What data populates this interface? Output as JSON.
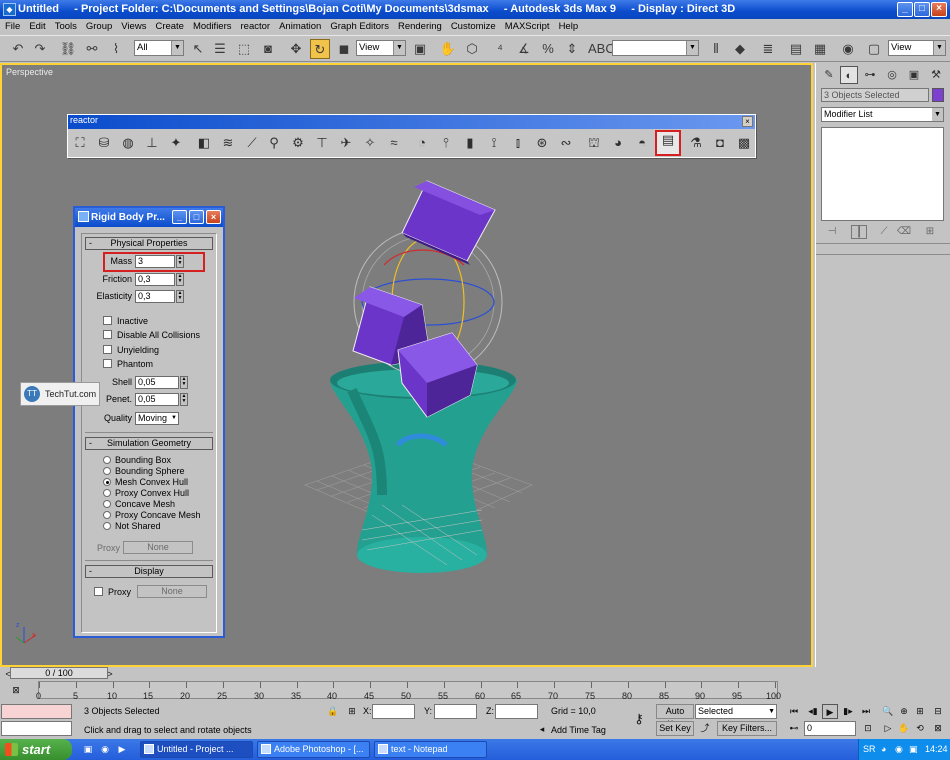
{
  "window": {
    "title": "Untitled     - Project Folder: C:\\Documents and Settings\\Bojan Coti\\My Documents\\3dsmax     - Autodesk 3ds Max 9     - Display : Direct 3D",
    "minimize": "_",
    "maximize": "□",
    "close": "×"
  },
  "menu": [
    "File",
    "Edit",
    "Tools",
    "Group",
    "Views",
    "Create",
    "Modifiers",
    "reactor",
    "Animation",
    "Graph Editors",
    "Rendering",
    "Customize",
    "MAXScript",
    "Help"
  ],
  "toolbar": {
    "selection_filter": "All",
    "ref_coord": "View",
    "named_selection": "",
    "view_dropdown": "View"
  },
  "viewport": {
    "label": "Perspective",
    "background": "#7d7d7d",
    "cube_color": "#6a35c8",
    "vase_color": "#2aa89a"
  },
  "reactor_toolbar": {
    "title": "reactor",
    "close": "×"
  },
  "rigid_body": {
    "title": "Rigid Body Pr...",
    "physical_header": "Physical Properties",
    "mass_label": "Mass",
    "mass_value": "3",
    "friction_label": "Friction",
    "friction_value": "0,3",
    "elasticity_label": "Elasticity",
    "elasticity_value": "0,3",
    "checks": [
      "Inactive",
      "Disable All Collisions",
      "Unyielding",
      "Phantom"
    ],
    "shell_label": "Shell",
    "shell_value": "0,05",
    "penet_label": "Penet.",
    "penet_value": "0,05",
    "quality_label": "Quality",
    "quality_value": "Moving",
    "sim_header": "Simulation Geometry",
    "geometry_options": [
      "Bounding Box",
      "Bounding Sphere",
      "Mesh Convex Hull",
      "Proxy Convex Hull",
      "Concave Mesh",
      "Proxy Concave Mesh",
      "Not Shared"
    ],
    "geometry_selected": "Mesh Convex Hull",
    "proxy_label": "Proxy",
    "proxy_button": "None",
    "display_header": "Display",
    "display_proxy_label": "Proxy",
    "display_proxy_button": "None"
  },
  "watermark": {
    "text": "TechTut.com",
    "logo": "TT"
  },
  "command_panel": {
    "selection_name": "3 Objects Selected",
    "object_color": "#7d3fcf",
    "modifier_list": "Modifier List"
  },
  "timeline": {
    "frame_display": "0 / 100",
    "ticks": [
      "0",
      "5",
      "10",
      "15",
      "20",
      "25",
      "30",
      "35",
      "40",
      "45",
      "50",
      "55",
      "60",
      "65",
      "70",
      "75",
      "80",
      "85",
      "90",
      "95",
      "100"
    ]
  },
  "status": {
    "selected_text": "3 Objects Selected",
    "prompt": "Click and drag to select and rotate objects",
    "x_label": "X:",
    "y_label": "Y:",
    "z_label": "Z:",
    "grid": "Grid = 10,0",
    "add_time_tag": "Add Time Tag",
    "auto_key": "Auto Key",
    "set_key": "Set Key",
    "selected_dropdown": "Selected",
    "key_filters": "Key Filters...",
    "current_frame": "0"
  },
  "taskbar": {
    "start": "start",
    "tasks": [
      "Untitled   - Project ...",
      "Adobe Photoshop - [...",
      "text - Notepad"
    ],
    "lang": "SR",
    "clock": "14:24"
  }
}
